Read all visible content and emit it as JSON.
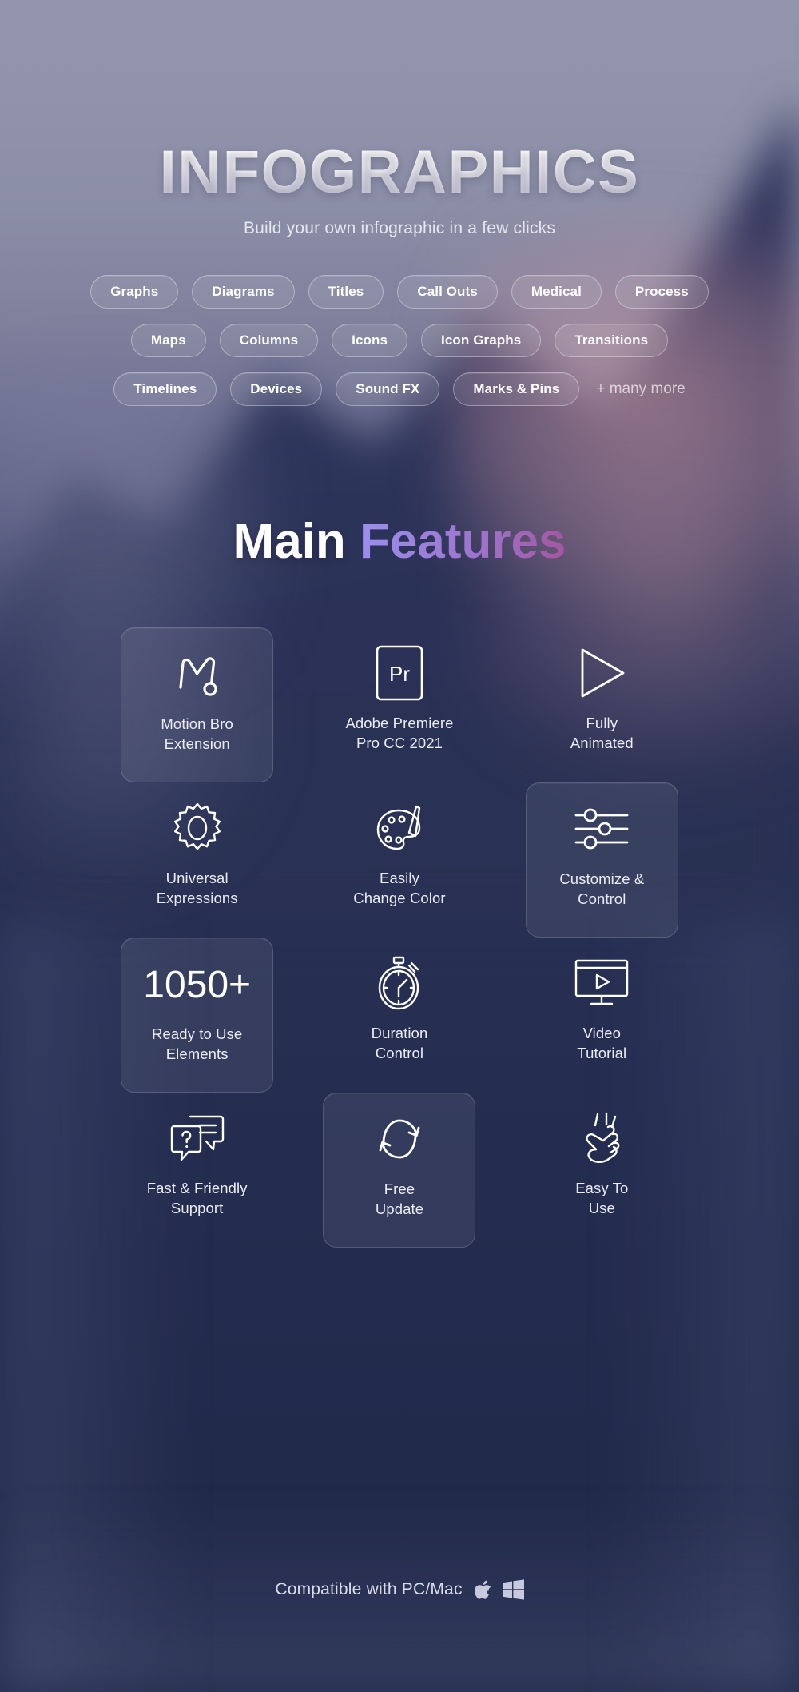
{
  "hero": {
    "title": "INFOGRAPHICS",
    "subtitle": "Build your own infographic in a few clicks"
  },
  "categories": {
    "rows": [
      [
        "Graphs",
        "Diagrams",
        "Titles",
        "Call Outs",
        "Medical",
        "Process"
      ],
      [
        "Maps",
        "Columns",
        "Icons",
        "Icon Graphs",
        "Transitions"
      ],
      [
        "Timelines",
        "Devices",
        "Sound FX",
        "Marks & Pins"
      ]
    ],
    "more_label": "+ many more"
  },
  "features_heading": {
    "part1": "Main ",
    "part2": "Features"
  },
  "features": [
    {
      "icon": "motion-bro-logo-icon",
      "line1": "Motion Bro",
      "line2": "Extension",
      "highlighted": true,
      "number": ""
    },
    {
      "icon": "adobe-premiere-pr-icon",
      "line1": "Adobe Premiere",
      "line2": "Pro CC 2021",
      "highlighted": false,
      "number": ""
    },
    {
      "icon": "play-triangle-icon",
      "line1": "Fully",
      "line2": "Animated",
      "highlighted": false,
      "number": ""
    },
    {
      "icon": "gear-icon",
      "line1": "Universal",
      "line2": "Expressions",
      "highlighted": false,
      "number": ""
    },
    {
      "icon": "color-palette-icon",
      "line1": "Easily",
      "line2": "Change Color",
      "highlighted": false,
      "number": ""
    },
    {
      "icon": "sliders-icon",
      "line1": "Customize &",
      "line2": "Control",
      "highlighted": true,
      "number": ""
    },
    {
      "icon": "number-badge",
      "line1": "Ready to Use",
      "line2": "Elements",
      "highlighted": true,
      "number": "1050+"
    },
    {
      "icon": "stopwatch-icon",
      "line1": "Duration",
      "line2": "Control",
      "highlighted": false,
      "number": ""
    },
    {
      "icon": "video-monitor-icon",
      "line1": "Video",
      "line2": "Tutorial",
      "highlighted": false,
      "number": ""
    },
    {
      "icon": "chat-question-icon",
      "line1": "Fast & Friendly",
      "line2": "Support",
      "highlighted": false,
      "number": ""
    },
    {
      "icon": "refresh-arrows-icon",
      "line1": "Free",
      "line2": "Update",
      "highlighted": true,
      "number": ""
    },
    {
      "icon": "snapping-fingers-icon",
      "line1": "Easy To",
      "line2": "Use",
      "highlighted": false,
      "number": ""
    }
  ],
  "footer": {
    "text": "Compatible with PC/Mac",
    "icons": [
      "apple-logo-icon",
      "windows-logo-icon"
    ]
  },
  "colors": {
    "accent_gradient_start": "#9b90ef",
    "accent_gradient_end": "#a4559f",
    "background_top": "#9295ab",
    "background_bottom": "#232b4e",
    "text_primary": "#ffffff",
    "text_secondary": "#dadced"
  }
}
